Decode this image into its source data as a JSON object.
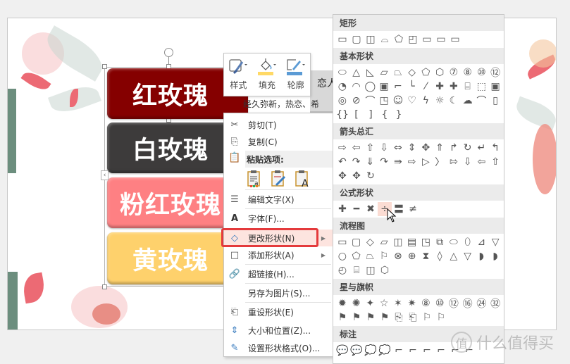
{
  "slide": {
    "roses": [
      {
        "label": "红玫瑰",
        "color": "#850000"
      },
      {
        "label": "白玫瑰",
        "color": "#3d3b3b"
      },
      {
        "label": "粉红玫瑰",
        "color": "#fe8083"
      },
      {
        "label": "黄玫瑰",
        "color": "#fed16c"
      }
    ],
    "behind_text_1": "恋人",
    "behind_text_2": "经久弥新，热恋、希"
  },
  "mini_toolbar": {
    "style_label": "样式",
    "fill_label": "填充",
    "outline_label": "轮廓",
    "fill_color": "#ffd966",
    "outline_color": "#5b9bd5"
  },
  "context_menu": {
    "items": [
      {
        "label": "剪切(T)",
        "icon": "scissors-icon"
      },
      {
        "label": "复制(C)",
        "icon": "copy-icon"
      },
      {
        "label": "粘贴选项:",
        "icon": "paste-icon"
      },
      {
        "label": "编辑文字(X)",
        "icon": "edit-text-icon"
      },
      {
        "label": "字体(F)...",
        "icon": "font-icon"
      },
      {
        "label": "更改形状(N)",
        "icon": "change-shape-icon",
        "submenu": true,
        "highlighted": true
      },
      {
        "label": "添加形状(A)",
        "icon": "add-shape-icon",
        "submenu": true
      },
      {
        "label": "超链接(H)...",
        "icon": "hyperlink-icon"
      },
      {
        "label": "另存为图片(S)...",
        "icon": ""
      },
      {
        "label": "重设形状(E)",
        "icon": "reset-shape-icon"
      },
      {
        "label": "大小和位置(Z)...",
        "icon": "size-position-icon"
      },
      {
        "label": "设置形状格式(O)...",
        "icon": "format-shape-icon"
      }
    ],
    "paste_options": [
      "keep-text-only",
      "use-destination-theme",
      "keep-source-formatting"
    ],
    "highlight_color": "#e43a3c"
  },
  "gallery": {
    "sections": [
      {
        "title": "矩形",
        "rows": [
          9
        ]
      },
      {
        "title": "基本形状",
        "rows": [
          12,
          12,
          12,
          5
        ]
      },
      {
        "title": "箭头总汇",
        "rows": [
          12,
          12,
          3
        ]
      },
      {
        "title": "公式形状",
        "rows": [
          6
        ]
      },
      {
        "title": "流程图",
        "rows": [
          12,
          12,
          4
        ]
      },
      {
        "title": "星与旗帜",
        "rows": [
          12,
          8
        ]
      },
      {
        "title": "标注",
        "rows": [
          10,
          4
        ]
      }
    ],
    "hovered_shape": "除号",
    "hover_color": "#fbdcd3"
  },
  "watermark": {
    "circle": "值",
    "text": "什么值得买"
  }
}
